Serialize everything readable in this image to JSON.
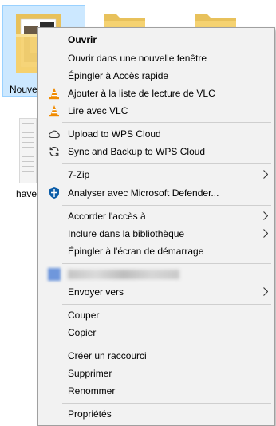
{
  "desktop": {
    "selected_folder_label": "Nouvea",
    "document_label": "have"
  },
  "menu": {
    "items": [
      {
        "label": "Ouvrir"
      },
      {
        "label": "Ouvrir dans une nouvelle fenêtre"
      },
      {
        "label": "Épingler à Accès rapide"
      },
      {
        "label": "Ajouter à la liste de lecture de VLC"
      },
      {
        "label": "Lire avec VLC"
      },
      {
        "label": "Upload to WPS Cloud"
      },
      {
        "label": "Sync and Backup to WPS Cloud"
      },
      {
        "label": "7-Zip"
      },
      {
        "label": "Analyser avec Microsoft Defender..."
      },
      {
        "label": "Accorder l'accès à"
      },
      {
        "label": "Inclure dans la bibliothèque"
      },
      {
        "label": "Épingler à l'écran de démarrage"
      },
      {
        "label": ""
      },
      {
        "label": "Envoyer vers"
      },
      {
        "label": "Couper"
      },
      {
        "label": "Copier"
      },
      {
        "label": "Créer un raccourci"
      },
      {
        "label": "Supprimer"
      },
      {
        "label": "Renommer"
      },
      {
        "label": "Propriétés"
      }
    ]
  },
  "colors": {
    "selection": "#cce8ff",
    "menu_bg": "#f2f2f2",
    "vlc_orange": "#f08a00",
    "defender_blue": "#0a5ca8"
  }
}
